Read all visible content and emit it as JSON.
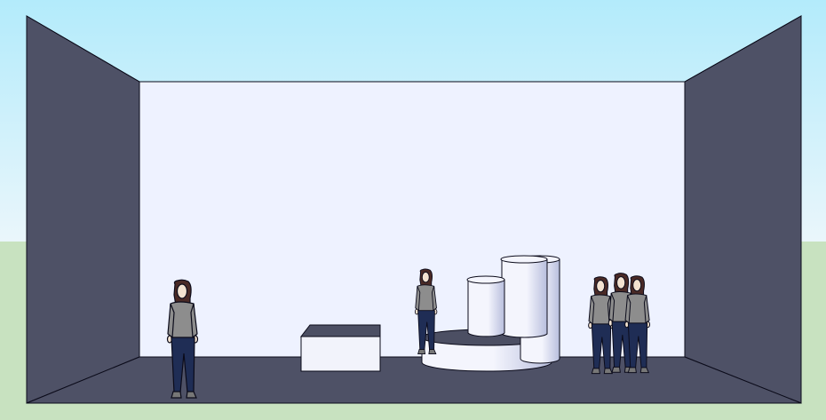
{
  "scene": {
    "description_free": true,
    "colors": {
      "sky_top": "#b3ebfb",
      "sky_bottom": "#eaf6fb",
      "ground": "#c8e2c0",
      "room_wall": "#4e5166",
      "back_wall": "#eef2ff",
      "floor": "#4e5166",
      "edge": "#0b0b1a",
      "block_top": "#4c4f63",
      "block_front": "#f2f3fb",
      "cylinder_light": "#f4f5fd",
      "cylinder_shade": "#b8bedd",
      "person_shirt": "#8d8d8d",
      "person_jeans": "#1f2d55",
      "person_hair": "#4a2a26",
      "person_skin": "#f3e2d0"
    },
    "objects": {
      "people_count": 5,
      "box_count": 1,
      "cylinder_count": 3
    }
  }
}
